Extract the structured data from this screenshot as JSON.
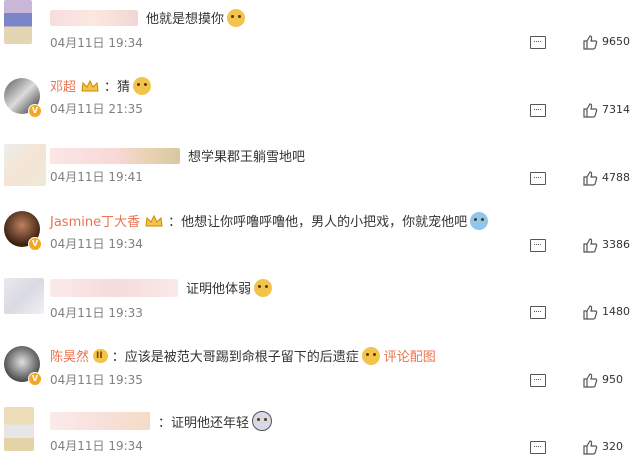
{
  "comments": [
    {
      "user": "",
      "badge": "",
      "text": "他就是想摸你",
      "extra": "",
      "date": "04月11日 19:34",
      "likes": "9650"
    },
    {
      "user": "邓超",
      "badge": "",
      "text": "：猜",
      "extra": "",
      "date": "04月11日 21:35",
      "likes": "7314"
    },
    {
      "user": "",
      "badge": "",
      "text": "想学果郡王躺雪地吧",
      "extra": "",
      "date": "04月11日 19:41",
      "likes": "4788"
    },
    {
      "user": "Jasmine丁大香",
      "badge": "",
      "text": "：他想让你呼噜呼噜他，男人的小把戏，你就宠他吧",
      "extra": "",
      "date": "04月11日 19:34",
      "likes": "3386"
    },
    {
      "user": "",
      "badge": "",
      "text": "证明他体弱",
      "extra": "",
      "date": "04月11日 19:33",
      "likes": "1480"
    },
    {
      "user": "陈昊然",
      "badge": "II",
      "text": "：应该是被范大哥踢到命根子留下的后遗症",
      "extra": "评论配图",
      "date": "04月11日 19:35",
      "likes": "950"
    },
    {
      "user": "",
      "badge": "",
      "text": "：证明他还年轻",
      "extra": "",
      "date": "04月11日 19:34",
      "likes": "320"
    }
  ],
  "colors": {
    "username": "#eb7350",
    "date": "#808080",
    "accent": "#f5a623"
  },
  "icons": {
    "reply": "reply-icon",
    "like": "thumbs-up-icon"
  }
}
